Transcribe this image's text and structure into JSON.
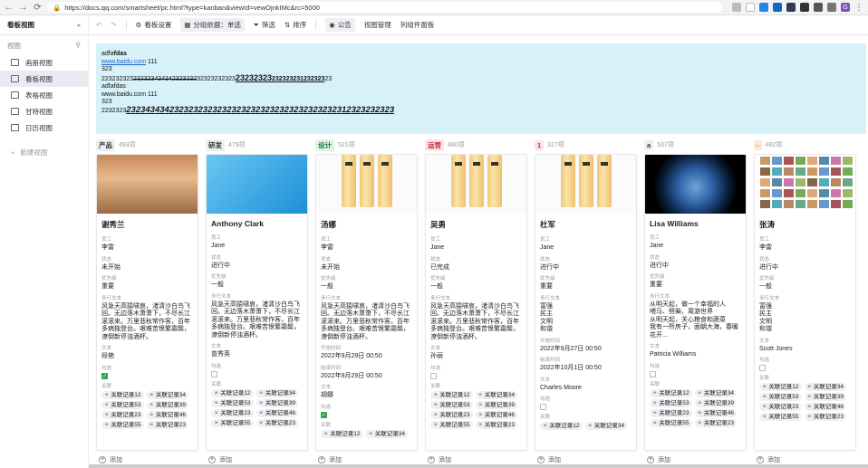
{
  "browser": {
    "url": "https://docs.qq.com/smartsheet/pc.html?type=kanban&viewId=vewOjnkIMc&rc=5000",
    "avatar": "G"
  },
  "toolbar": {
    "title": "看板视图",
    "undo": "↶",
    "redo": "↷",
    "settings": "看板设置",
    "group": "分组依据：单选",
    "filter": "筛选",
    "sort": "排序",
    "notice": "公告",
    "view_manage": "视图管理",
    "component": "列组件面板"
  },
  "sidebar": {
    "section": "视图",
    "items": [
      "画册视图",
      "看板视图",
      "表格视图",
      "甘特视图",
      "日历视图"
    ],
    "add": "新建视图"
  },
  "banner": {
    "l1a": "adfa",
    "l1b": "fdas",
    "l2link": "www.baidu.com",
    "l2b": " 111",
    "l3": "323",
    "l4a": "223232323",
    "l4b": "232323434342323232",
    "l4c": "32323232323",
    "l4d": "23232323",
    "l4e": "232323231232323",
    "l4f": "23",
    "l5": "adfafdas",
    "l6": "www.baidu.com 111",
    "l7": "323",
    "l8a": "2232323",
    "l8b": "23234343423232323232323232323232323232323232312323232323"
  },
  "columns": [
    {
      "tag": "产品",
      "count": "493项",
      "tagbg": "#eceef1",
      "tagfg": "#333",
      "img": "anime",
      "title": "谢秀兰",
      "emp": "李雷",
      "status": "未开始",
      "priority": "重要",
      "multitext": "风急天高猿啸哀，渚清沙白鸟飞回。无边落木萧萧下，不尽长江滚滚来。万里悲秋常作客，百年多病独登台。艰难苦恨繁霜鬓，潦倒新停浊酒杯。",
      "text": "段艳",
      "checked": true,
      "links": [
        "关联记录12",
        "关联记录34",
        "关联记录53",
        "关联记录39",
        "关联记录23",
        "关联记录46",
        "关联记录55",
        "关联记录23"
      ]
    },
    {
      "tag": "研发",
      "count": "479项",
      "tagbg": "#eceef1",
      "tagfg": "#333",
      "img": "penguin",
      "title": "Anthony Clark",
      "emp": "Jane",
      "status": "进行中",
      "priority": "一般",
      "multitext": "风急天高猿啸哀，渚清沙白鸟飞回。无边落木萧萧下，不尽长江滚滚来。万里悲秋常作客，百年多病独登台。艰难苦恨繁霜鬓，潦倒新停浊酒杯。",
      "text": "曾秀英",
      "checked": false,
      "links": [
        "关联记录12",
        "关联记录34",
        "关联记录53",
        "关联记录39",
        "关联记录23",
        "关联记录46",
        "关联记录55",
        "关联记录23"
      ]
    },
    {
      "tag": "设计",
      "count": "521项",
      "tagbg": "#dff4e4",
      "tagfg": "#1b7a36",
      "img": "bottles",
      "title": "汤娜",
      "emp": "李雷",
      "status": "未开始",
      "priority": "一般",
      "multitext": "风急天高猿啸哀，渚清沙白鸟飞回。无边落木萧萧下，不尽长江滚滚来。万里悲秋常作客，百年多病独登台。艰难苦恨繁霜鬓，潦倒新停浊酒杯。",
      "start": "2022年9月29日 00:50",
      "end": "2022年9月29日 00:50",
      "text": "胡娜",
      "checked": true,
      "links": [
        "关联记录12",
        "关联记录34"
      ]
    },
    {
      "tag": "运营",
      "count": "480项",
      "tagbg": "#fde3e6",
      "tagfg": "#c9283c",
      "img": "bottles",
      "title": "吴勇",
      "emp": "Jane",
      "status": "已完成",
      "priority": "一般",
      "multitext": "风急天高猿啸哀，渚清沙白鸟飞回。无边落木萧萧下，不尽长江滚滚来。万里悲秋常作客，百年多病独登台。艰难苦恨繁霜鬓，潦倒新停浊酒杯。",
      "text": "孙丽",
      "checked": false,
      "links": [
        "关联记录12",
        "关联记录34",
        "关联记录53",
        "关联记录39",
        "关联记录23",
        "关联记录46",
        "关联记录55",
        "关联记录23"
      ]
    },
    {
      "tag": "1",
      "count": "327项",
      "tagbg": "#fde3e6",
      "tagfg": "#c9283c",
      "img": "bottles",
      "title": "杜军",
      "emp": "Jane",
      "status": "进行中",
      "priority": "重要",
      "multitext": "富强\n民主\n文明\n和谐",
      "start": "2022年9月27日 00:50",
      "end": "2022年10月1日 00:50",
      "text": "Charles Moore",
      "checked": false,
      "links": [
        "关联记录12",
        "关联记录34"
      ]
    },
    {
      "tag": "a",
      "count": "507项",
      "tagbg": "#eceef1",
      "tagfg": "#333",
      "img": "earth",
      "title": "Lisa Williams",
      "emp": "Jane",
      "status": "进行中",
      "priority": "重要",
      "multitext": "从明天起，做一个幸福的人\n喂马、劈柴、周游世界\n从明天起，关心粮食和蔬菜\n我有一所房子，面朝大海，春暖花开...",
      "text": "Patricia Williams",
      "checked": false,
      "links": [
        "关联记录12",
        "关联记录34",
        "关联记录53",
        "关联记录39",
        "关联记录23",
        "关联记录46",
        "关联记录55",
        "关联记录23"
      ]
    },
    {
      "tag": "-",
      "count": "482项",
      "tagbg": "#fde8d6",
      "tagfg": "#c06a1a",
      "img": "collage",
      "title": "张涛",
      "emp": "李雷",
      "status": "进行中",
      "priority": "一般",
      "multitext": "富强\n民主\n文明\n和谐",
      "text": "Scott Jones",
      "checked": false,
      "links": [
        "关联记录12",
        "关联记录34",
        "关联记录53",
        "关联记录39",
        "关联记录23",
        "关联记录46",
        "关联记录55",
        "关联记录23"
      ]
    }
  ],
  "labels": {
    "emp": "员工",
    "status": "状态",
    "priority": "优先级",
    "multitext": "多行文本",
    "start": "开始时间",
    "end": "结束时间",
    "text": "文本",
    "check": "勾选",
    "links": "关联",
    "add": "添加"
  }
}
